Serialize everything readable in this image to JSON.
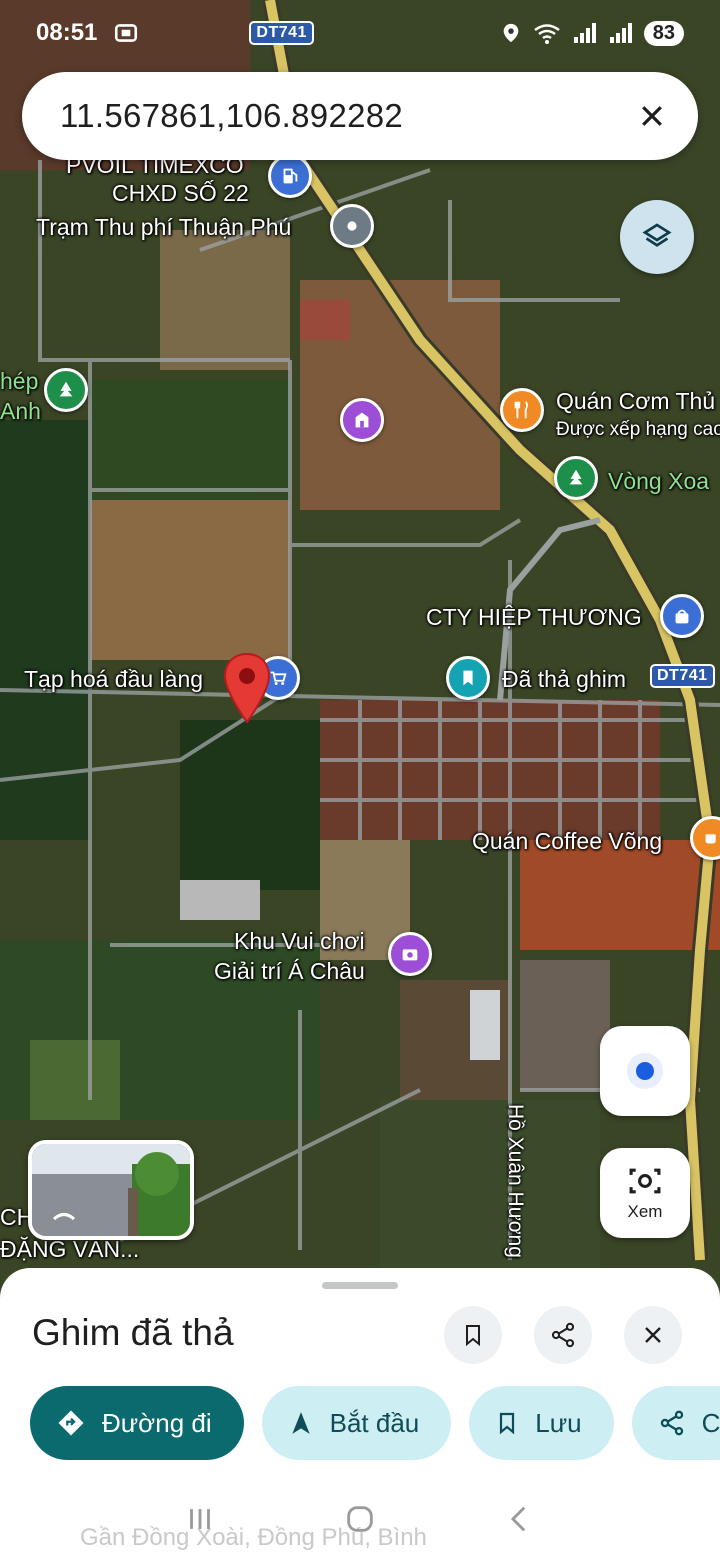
{
  "status_bar": {
    "time": "08:51",
    "road_shield": "DT741",
    "battery": "83"
  },
  "search": {
    "query": "11.567861,106.892282"
  },
  "map": {
    "labels": {
      "pvoil": "PVOIL TIMEXCO",
      "chxd": "CHXD SỐ 22",
      "toll": "Trạm Thu phí Thuận Phú",
      "nhep": "hép",
      "anh": "Anh",
      "quan_com": "Quán Cơm Thủ",
      "rated": "Được xếp hạng cao",
      "vong_xoay": "Vòng Xoa",
      "cty": "CTY HIỆP THƯƠNG",
      "tap_hoa": "Tạp hoá đầu làng",
      "dropped": "Đã thả ghim",
      "coffee": "Quán Coffee Võng",
      "khu_vui_1": "Khu Vui chơi",
      "khu_vui_2": "Giải trí Á Châu",
      "street": "Hồ Xuân Hương",
      "dang_van_1": "CH",
      "dang_van_2": "ĐẶNG VĂN..."
    },
    "road_shield": "DT741"
  },
  "buttons": {
    "lens_label": "Xem"
  },
  "sheet": {
    "title": "Ghim đã thả",
    "chips": {
      "directions": "Đường đi",
      "start": "Bắt đầu",
      "save": "Lưu",
      "share": "C"
    },
    "address": "Gần Đồng Xoài, Đồng Phú, Bình"
  },
  "colors": {
    "accent": "#0b6a6e",
    "chip_secondary": "#cdeef3",
    "pin": "#e53935",
    "road_main": "#d9c464"
  }
}
